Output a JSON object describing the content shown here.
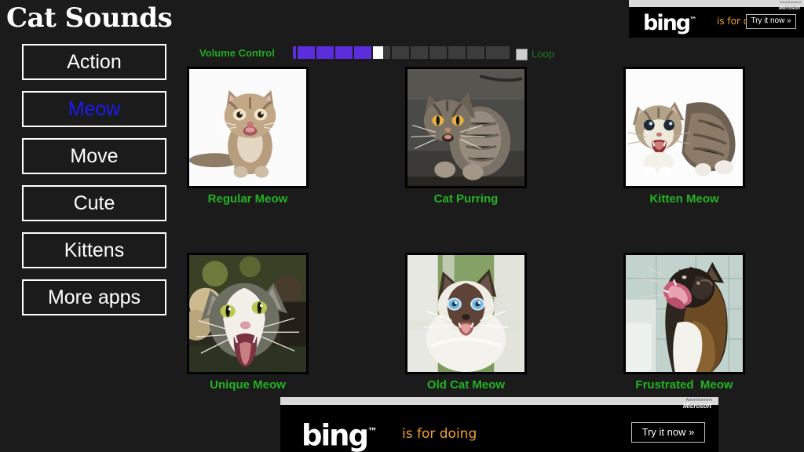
{
  "app": {
    "title": "Cat Sounds",
    "background_color": "#1b1b1b"
  },
  "sidebar": {
    "items": [
      {
        "label": "Action",
        "active": false
      },
      {
        "label": "Meow",
        "active": true
      },
      {
        "label": "Move",
        "active": false
      },
      {
        "label": "Cute",
        "active": false
      },
      {
        "label": "Kittens",
        "active": false
      },
      {
        "label": "More apps",
        "active": false
      }
    ],
    "active_color": "#1b1bf5",
    "inactive_color": "#ffffff"
  },
  "controls": {
    "volume_label": "Volume Control",
    "volume_percent": 38,
    "volume_fill_color": "#5b2ddd",
    "volume_track_color": "#3c3c3c",
    "volume_thumb_color": "#ffffff",
    "loop_label": "Loop",
    "loop_checked": false,
    "label_color": "#1faa1f"
  },
  "grid": {
    "label_color": "#22b322",
    "tiles": [
      {
        "label": "Regular Meow",
        "image": "tabby-kitten-smiling-white-bg"
      },
      {
        "label": "Cat Purring",
        "image": "grey-tabby-cat-on-concrete"
      },
      {
        "label": "Kitten Meow",
        "image": "two-tabby-kittens-hissing-white-bg"
      },
      {
        "label": "Unique Meow",
        "image": "white-grey-cat-yawning-closeup"
      },
      {
        "label": "Old Cat Meow",
        "image": "himalayan-cat-blue-eyes-meowing"
      },
      {
        "label": "Frustrated  Meow",
        "image": "calico-cat-yawning-bathroom-tile"
      }
    ]
  },
  "ads": {
    "top": {
      "advertisement_text": "Advertisement",
      "provider_text": "Microsoft",
      "brand": "bing",
      "brand_tm": "™",
      "tagline": "is for doing",
      "cta": "Try it now »"
    },
    "bottom": {
      "advertisement_text": "Advertisement",
      "provider_text": "Microsoft",
      "brand": "bing",
      "brand_tm": "™",
      "tagline": "is for doing",
      "cta": "Try it now »"
    }
  }
}
